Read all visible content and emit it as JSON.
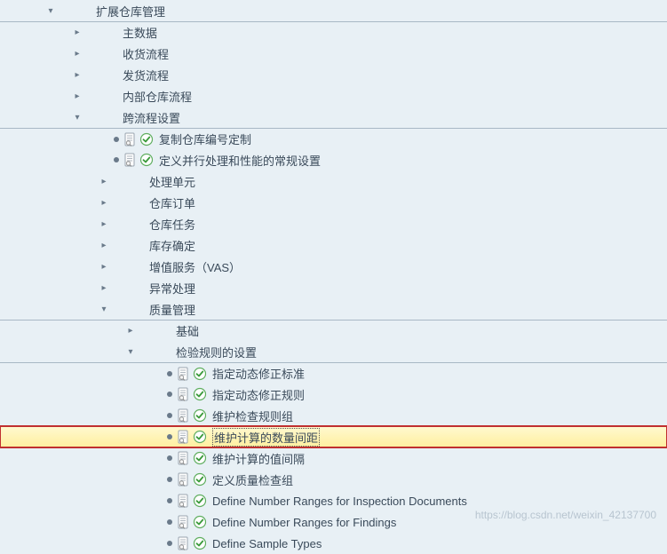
{
  "watermark": "https://blog.csdn.net/weixin_42137700",
  "icons": {
    "expanded": "▾",
    "collapsed": "▸"
  },
  "rows": [
    {
      "indent": 50,
      "expander": "expanded",
      "icons": false,
      "bullet": false,
      "label": "扩展仓库管理",
      "borderTop": false
    },
    {
      "indent": 80,
      "expander": "collapsed",
      "icons": false,
      "bullet": false,
      "label": "主数据",
      "borderTop": true
    },
    {
      "indent": 80,
      "expander": "collapsed",
      "icons": false,
      "bullet": false,
      "label": "收货流程",
      "borderTop": false
    },
    {
      "indent": 80,
      "expander": "collapsed",
      "icons": false,
      "bullet": false,
      "label": "发货流程",
      "borderTop": false
    },
    {
      "indent": 80,
      "expander": "collapsed",
      "icons": false,
      "bullet": false,
      "label": "内部仓库流程",
      "borderTop": false
    },
    {
      "indent": 80,
      "expander": "expanded",
      "icons": false,
      "bullet": false,
      "label": "跨流程设置",
      "borderTop": false
    },
    {
      "indent": 106,
      "expander": "none",
      "icons": true,
      "bullet": true,
      "label": "复制仓库编号定制",
      "borderTop": true
    },
    {
      "indent": 106,
      "expander": "none",
      "icons": true,
      "bullet": true,
      "label": "定义并行处理和性能的常规设置",
      "borderTop": false
    },
    {
      "indent": 110,
      "expander": "collapsed",
      "icons": false,
      "bullet": false,
      "label": "处理单元",
      "borderTop": false
    },
    {
      "indent": 110,
      "expander": "collapsed",
      "icons": false,
      "bullet": false,
      "label": "仓库订单",
      "borderTop": false
    },
    {
      "indent": 110,
      "expander": "collapsed",
      "icons": false,
      "bullet": false,
      "label": "仓库任务",
      "borderTop": false
    },
    {
      "indent": 110,
      "expander": "collapsed",
      "icons": false,
      "bullet": false,
      "label": "库存确定",
      "borderTop": false
    },
    {
      "indent": 110,
      "expander": "collapsed",
      "icons": false,
      "bullet": false,
      "label": "增值服务（VAS）",
      "borderTop": false
    },
    {
      "indent": 110,
      "expander": "collapsed",
      "icons": false,
      "bullet": false,
      "label": "异常处理",
      "borderTop": false
    },
    {
      "indent": 110,
      "expander": "expanded",
      "icons": false,
      "bullet": false,
      "label": "质量管理",
      "borderTop": false
    },
    {
      "indent": 140,
      "expander": "collapsed",
      "icons": false,
      "bullet": false,
      "label": "基础",
      "borderTop": true
    },
    {
      "indent": 140,
      "expander": "expanded",
      "icons": false,
      "bullet": false,
      "label": "检验规则的设置",
      "borderTop": false
    },
    {
      "indent": 166,
      "expander": "none",
      "icons": true,
      "bullet": true,
      "label": "指定动态修正标准",
      "borderTop": true
    },
    {
      "indent": 166,
      "expander": "none",
      "icons": true,
      "bullet": true,
      "label": "指定动态修正规则",
      "borderTop": false
    },
    {
      "indent": 166,
      "expander": "none",
      "icons": true,
      "bullet": true,
      "label": "维护检查规则组",
      "borderTop": false
    },
    {
      "indent": 166,
      "expander": "none",
      "icons": true,
      "bullet": true,
      "label": "维护计算的数量间距",
      "borderTop": false,
      "selected": true,
      "highlight": true,
      "cursor": true
    },
    {
      "indent": 166,
      "expander": "none",
      "icons": true,
      "bullet": true,
      "label": "维护计算的值间隔",
      "borderTop": false
    },
    {
      "indent": 166,
      "expander": "none",
      "icons": true,
      "bullet": true,
      "label": "定义质量检查组",
      "borderTop": false
    },
    {
      "indent": 166,
      "expander": "none",
      "icons": true,
      "bullet": true,
      "label": "Define Number Ranges for Inspection Documents",
      "borderTop": false
    },
    {
      "indent": 166,
      "expander": "none",
      "icons": true,
      "bullet": true,
      "label": "Define Number Ranges for Findings",
      "borderTop": false
    },
    {
      "indent": 166,
      "expander": "none",
      "icons": true,
      "bullet": true,
      "label": "Define Sample Types",
      "borderTop": false
    }
  ]
}
